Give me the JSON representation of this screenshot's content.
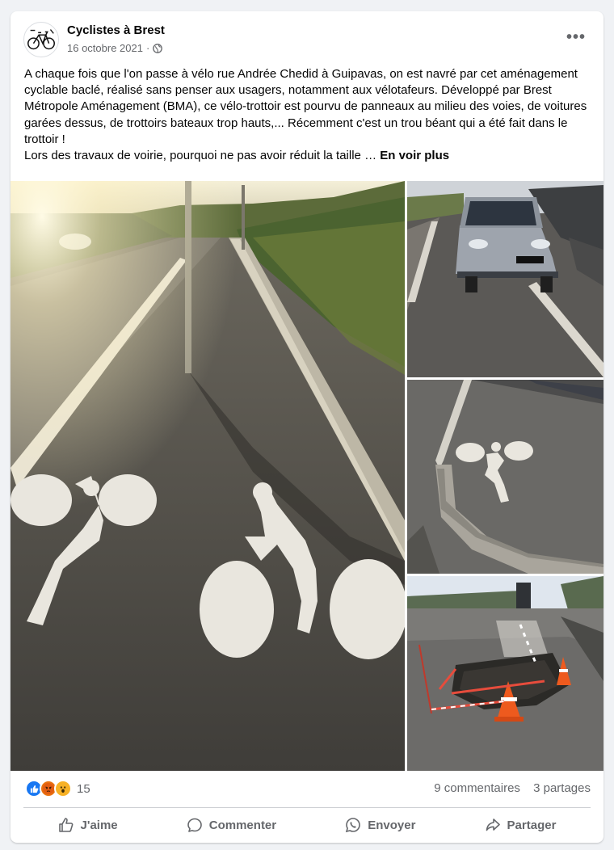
{
  "post": {
    "page_name": "Cyclistes à Brest",
    "date": "16 octobre 2021",
    "separator": "·",
    "privacy_icon": "globe-icon",
    "more_icon": "more-options-icon",
    "more_label": "•••",
    "text_lines": [
      "A chaque fois que l'on passe à vélo rue Andrée Chedid à Guipavas, on est navré par cet aménagement cyclable baclé, réalisé sans penser aux usagers, notamment aux vélotafeurs. Développé par Brest Métropole Aménagement (BMA), ce vélo-trottoir est pourvu de panneaux au milieu des voies, de voitures garées dessus, de trottoirs bateaux trop hauts,... Récemment c'est un trou béant qui a été fait dans le trottoir !",
      "Lors des travaux de voirie, pourquoi ne pas avoir réduit la taille …"
    ],
    "see_more": "En voir plus"
  },
  "photos": [
    {
      "name": "photo-bike-lane-sunset"
    },
    {
      "name": "photo-parked-car"
    },
    {
      "name": "photo-bike-marking-curb"
    },
    {
      "name": "photo-hole-roadworks"
    }
  ],
  "stats": {
    "reaction_icons": [
      "like-icon",
      "angry-icon",
      "wow-icon"
    ],
    "reaction_count": "15",
    "comments": "9 commentaires",
    "shares": "3 partages"
  },
  "actions": {
    "like": "J'aime",
    "comment": "Commenter",
    "send": "Envoyer",
    "share": "Partager"
  },
  "colors": {
    "background": "#f0f2f5",
    "card": "#ffffff",
    "secondary_text": "#65676b",
    "like_blue": "#1877f2"
  }
}
